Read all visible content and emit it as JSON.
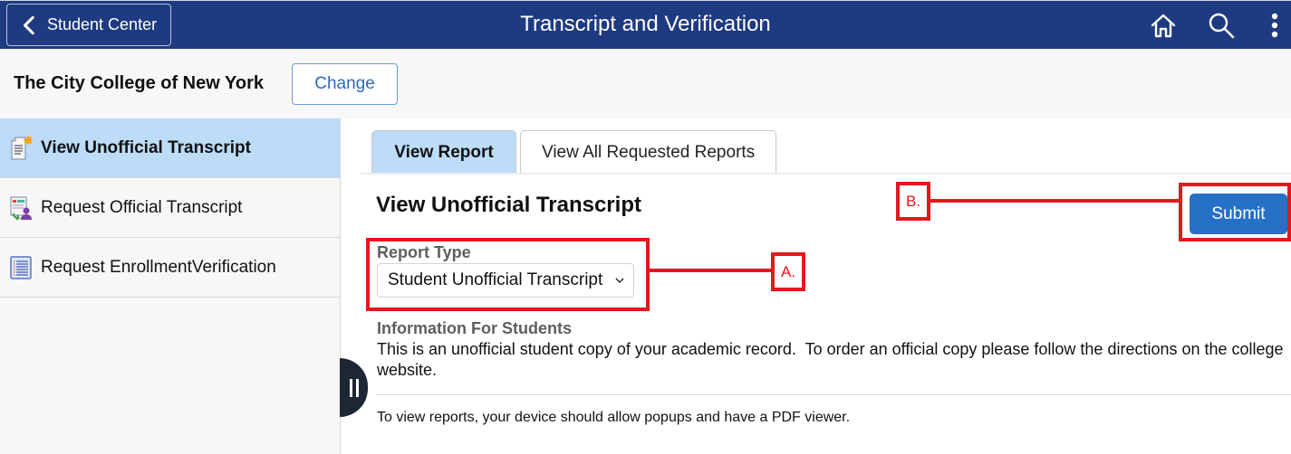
{
  "header": {
    "back_label": "Student Center",
    "title": "Transcript and Verification",
    "icons": [
      "home-icon",
      "search-icon",
      "more-vertical-icon"
    ]
  },
  "institution": {
    "name": "The City College of New York",
    "change_label": "Change"
  },
  "sidebar": {
    "items": [
      {
        "label": "View Unofficial Transcript",
        "icon": "unofficial-transcript-icon",
        "active": true
      },
      {
        "label": "Request Official Transcript",
        "icon": "official-transcript-request-icon",
        "active": false
      },
      {
        "label": "Request EnrollmentVerification",
        "icon": "enrollment-verification-icon",
        "active": false
      }
    ]
  },
  "main": {
    "tabs": [
      {
        "label": "View Report",
        "active": true
      },
      {
        "label": "View All Requested Reports",
        "active": false
      }
    ],
    "section_title": "View Unofficial Transcript",
    "submit_label": "Submit",
    "report_type": {
      "label": "Report Type",
      "selected": "Student Unofficial Transcript"
    },
    "info": {
      "title": "Information For Students",
      "body": "This is an unofficial student copy of your academic record.  To order an official copy please follow the directions on the college website."
    },
    "popup_note": "To view reports, your device should allow popups and have a PDF viewer."
  },
  "annotations": {
    "a_label": "A.",
    "b_label": "B.",
    "color": "#e3171e"
  },
  "colors": {
    "header_bg": "#1e3a80",
    "active_bg": "#bcdcf8",
    "primary_button": "#2670c8"
  }
}
